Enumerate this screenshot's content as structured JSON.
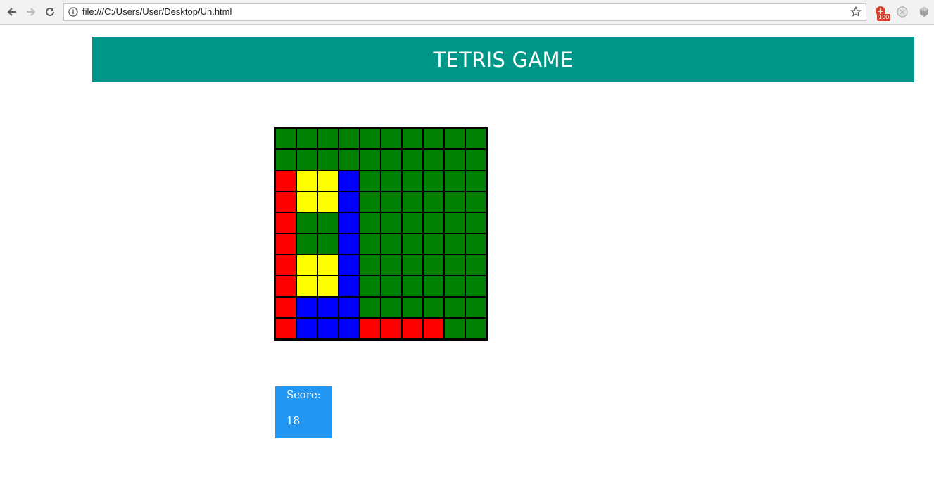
{
  "browser": {
    "url": "file:///C:/Users/User/Desktop/Un.html",
    "extension_badge": "100",
    "icons": [
      "back-arrow-icon",
      "forward-arrow-icon",
      "reload-icon",
      "info-icon",
      "bookmark-star-icon",
      "extension-icon"
    ]
  },
  "header": {
    "title": "TETRIS GAME",
    "background_color": "#009688"
  },
  "board": {
    "columns": 10,
    "rows": 10,
    "colors": {
      "G": "#008000",
      "R": "#ff0000",
      "Y": "#ffff00",
      "B": "#0000ff"
    },
    "cells": [
      "GGGGGGGGGG",
      "GGGGGGGGGG",
      "RYYBGGGGGG",
      "RYYBGGGGGG",
      "RGGBGGGGGG",
      "RGGBGGGGGG",
      "RYYBGGGGGG",
      "RYYBGGGGGG",
      "RBBBGGGGGG",
      "RBBBRRRRGG"
    ]
  },
  "score": {
    "label": "Score:",
    "value": "18",
    "background_color": "#2196f3"
  }
}
